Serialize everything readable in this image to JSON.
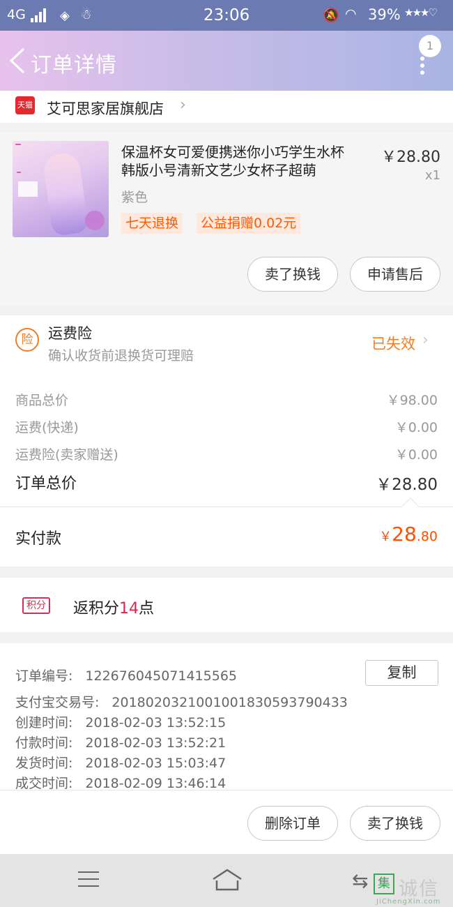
{
  "status_bar": {
    "network": "4G",
    "time": "23:06",
    "battery": "39%"
  },
  "nav": {
    "title": "订单详情",
    "badge_count": "1"
  },
  "shop": {
    "badge": "天猫",
    "name": "艾可思家居旗舰店"
  },
  "product": {
    "title_line1": "保温杯女可爱便携迷你小巧学生水杯",
    "title_line2": "韩版小号清新文艺少女杯子超萌",
    "price": "￥28.80",
    "qty": "x1",
    "spec": "紫色",
    "tags": [
      "七天退换",
      "公益捐赠0.02元"
    ],
    "buttons": [
      "卖了换钱",
      "申请售后"
    ]
  },
  "insurance": {
    "icon_text": "险",
    "title": "运费险",
    "desc": "确认收货前退换货可理赔",
    "status": "已失效"
  },
  "summary": {
    "rows": [
      {
        "label": "商品总价",
        "value": "￥98.00"
      },
      {
        "label": "运费(快递)",
        "value": "￥0.00"
      },
      {
        "label": "运费险(卖家赠送)",
        "value": "￥0.00"
      }
    ],
    "total_label": "订单总价",
    "total_value": "￥28.80"
  },
  "paid": {
    "label": "实付款",
    "currency": "￥",
    "integer": "28",
    "decimal": ".80"
  },
  "points": {
    "tag": "积分",
    "text_prefix": "返积分",
    "count": "14",
    "text_suffix": "点"
  },
  "order_info": {
    "copy_label": "复制",
    "rows": [
      {
        "label": "订单编号:",
        "value": "122676045071415565"
      },
      {
        "label": "支付宝交易号:",
        "value": "2018020321001001830593790433"
      },
      {
        "label": "创建时间:",
        "value": "2018-02-03 13:52:15"
      },
      {
        "label": "付款时间:",
        "value": "2018-02-03 13:52:21"
      },
      {
        "label": "发货时间:",
        "value": "2018-02-03 15:03:47"
      },
      {
        "label": "成交时间:",
        "value": "2018-02-09 13:46:14"
      }
    ]
  },
  "bottom_buttons": [
    "删除订单",
    "卖了换钱"
  ],
  "watermark": {
    "logo": "集",
    "cn": "诚信",
    "url": "JiChengXin.com"
  },
  "colors": {
    "accent_orange": "#ff5000",
    "status_orange": "#f07d26",
    "points_red": "#e0244e",
    "tmall_red": "#e5282f"
  }
}
